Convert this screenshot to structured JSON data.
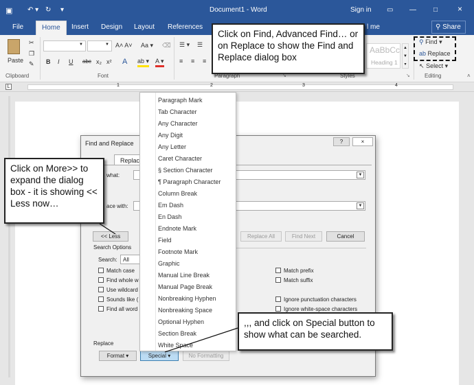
{
  "titlebar": {
    "doc_title": "Document1 - Word",
    "sign_in": "Sign in"
  },
  "tabs": [
    "File",
    "Home",
    "Insert",
    "Design",
    "Layout",
    "References",
    "l me"
  ],
  "share_label": "Share",
  "ribbon": {
    "paste_label": "Paste",
    "groups": {
      "clipboard": "Clipboard",
      "font": "Font",
      "paragraph": "Paragraph",
      "styles": "Styles",
      "editing": "Editing"
    },
    "font_buttons": [
      "B",
      "I",
      "U",
      "abc",
      "x₂",
      "x²"
    ],
    "style_preview": "AaBbCc",
    "style_name": "Heading 1",
    "editing": {
      "find": "Find",
      "replace": "Replace",
      "select": "Select"
    }
  },
  "dialog": {
    "title": "Find and Replace",
    "help": "?",
    "close": "×",
    "tabs": {
      "find": "d",
      "replace": "Replace"
    },
    "find_label": "what:",
    "replace_label": "ace with:",
    "less_button": "<< Less",
    "replace_all": "Replace All",
    "find_next": "Find Next",
    "cancel": "Cancel",
    "search_options": "Search Options",
    "search_label": "Search:",
    "search_value": "All",
    "left_options": [
      "Match case",
      "Find whole w",
      "Use wildcard",
      "Sounds like (",
      "Find all word"
    ],
    "right_options": [
      "Match prefix",
      "Match suffix",
      "Ignore punctuation characters",
      "Ignore white-space characters"
    ],
    "replace_section": "Replace",
    "format_button": "Format ▾",
    "special_button": "Special ▾",
    "no_formatting": "No Formatting"
  },
  "special_menu": [
    "Paragraph Mark",
    "Tab Character",
    "Any Character",
    "Any Digit",
    "Any Letter",
    "Caret Character",
    "§ Section Character",
    "¶ Paragraph Character",
    "Column Break",
    "Em Dash",
    "En Dash",
    "Endnote Mark",
    "Field",
    "Footnote Mark",
    "Graphic",
    "Manual Line Break",
    "Manual Page Break",
    "Nonbreaking Hyphen",
    "Nonbreaking Space",
    "Optional Hyphen",
    "Section Break",
    "White Space"
  ],
  "callouts": {
    "find": "Click on Find, Advanced Find… or on Replace to show the Find and Replace dialog box",
    "more": "Click on More>> to expand the dialog box - it is showing << Less now…",
    "special": ",,, and click on Special button to show what can be searched."
  }
}
